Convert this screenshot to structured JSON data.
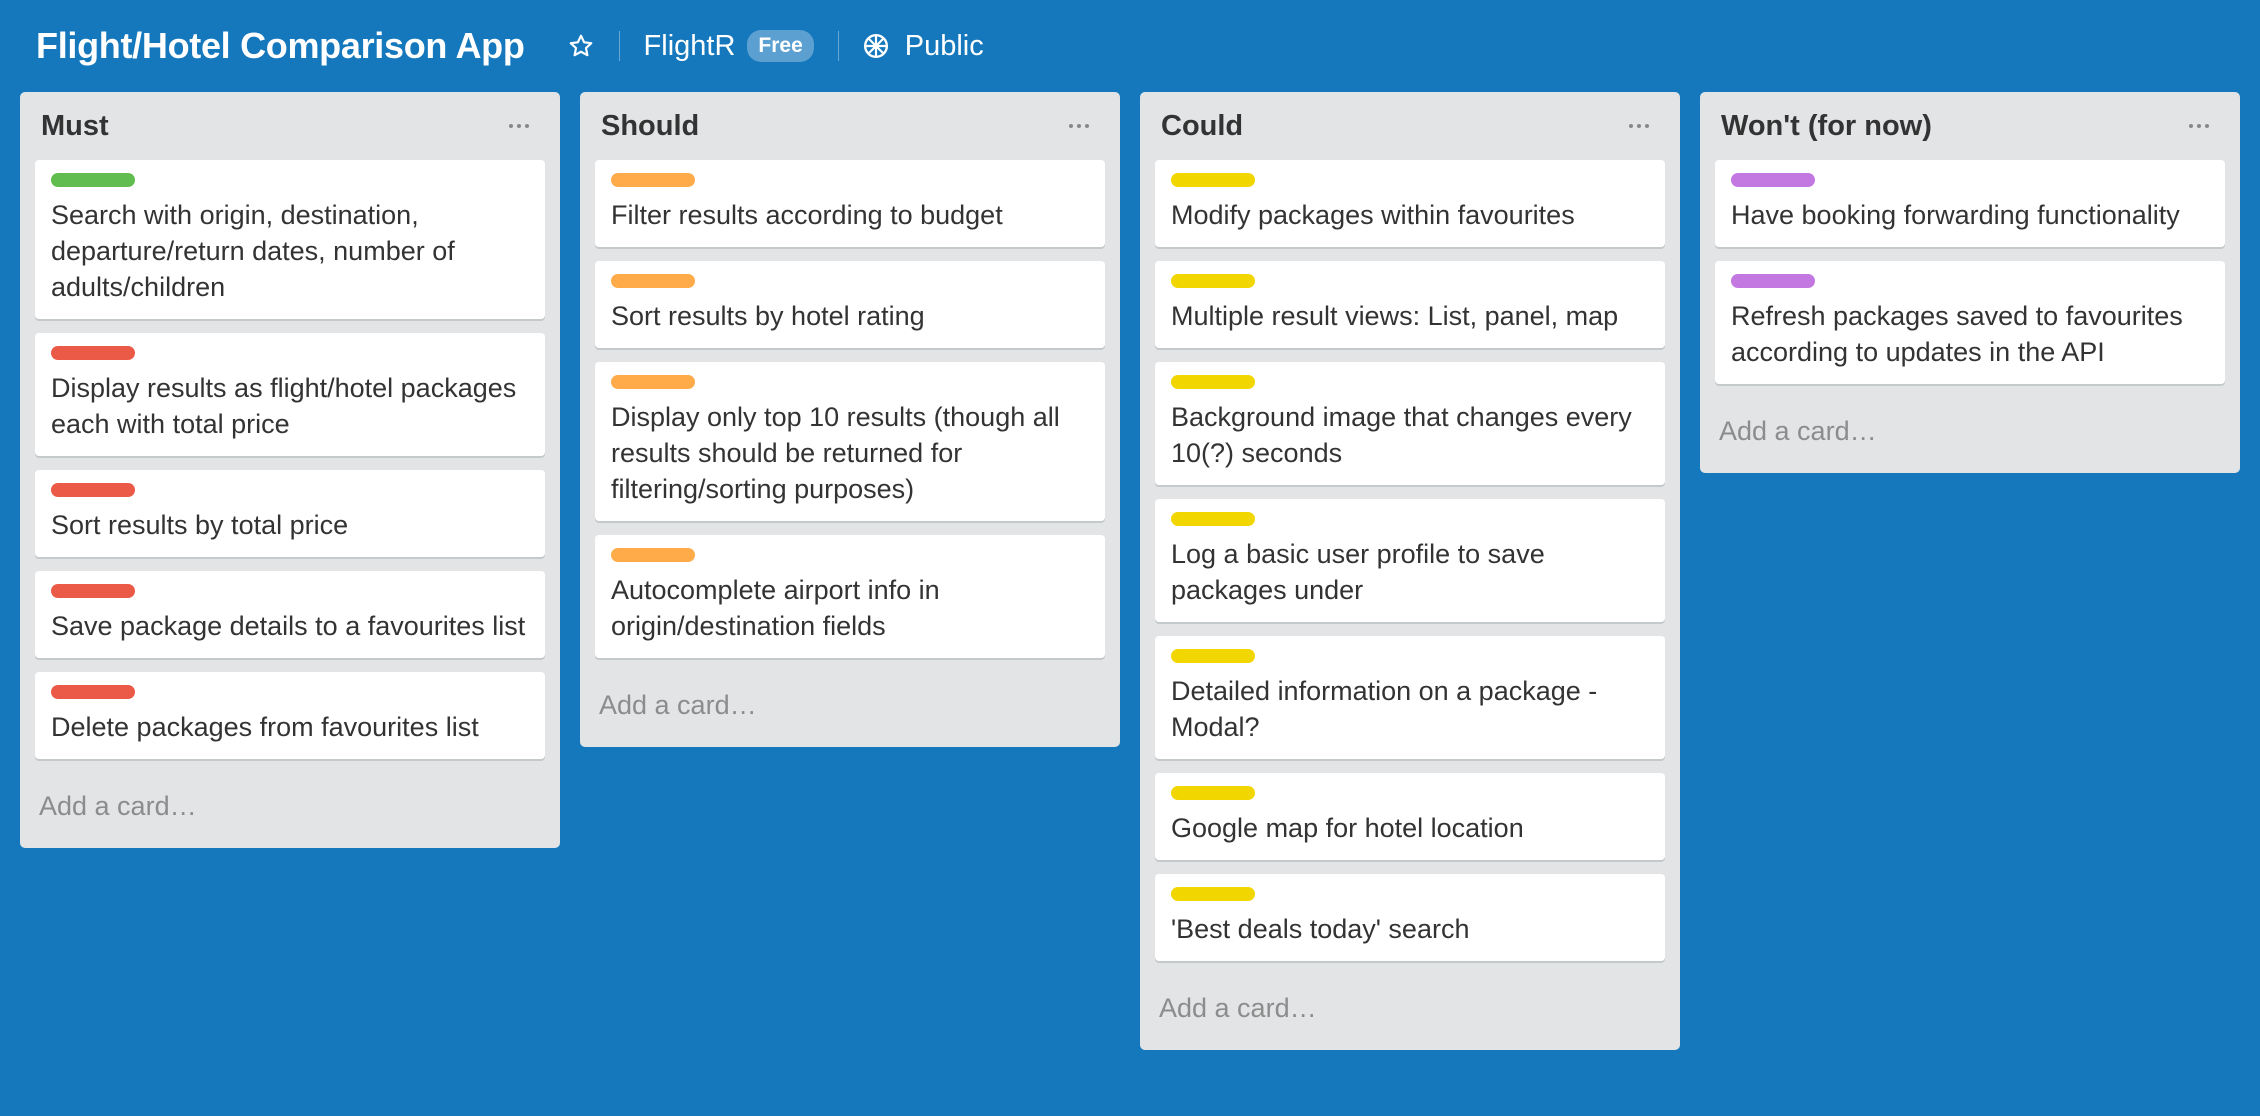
{
  "board": {
    "title": "Flight/Hotel Comparison App",
    "team": "FlightR",
    "plan_badge": "Free",
    "visibility": "Public",
    "icons": {
      "star": "star-icon",
      "visibility": "globe-icon"
    }
  },
  "colors": {
    "background": "#1578bd",
    "green": "#61bd4f",
    "red": "#eb5a46",
    "orange": "#ffab4a",
    "yellow": "#f2d600",
    "purple": "#c377e0"
  },
  "lists": [
    {
      "title": "Must",
      "add_card": "Add a card…",
      "cards": [
        {
          "label_color": "#61bd4f",
          "text": "Search with origin, destination, departure/return dates, number of adults/children"
        },
        {
          "label_color": "#eb5a46",
          "text": "Display results as flight/hotel packages each with total price"
        },
        {
          "label_color": "#eb5a46",
          "text": "Sort results by total price"
        },
        {
          "label_color": "#eb5a46",
          "text": "Save package details to a favourites list"
        },
        {
          "label_color": "#eb5a46",
          "text": "Delete packages from favourites list"
        }
      ]
    },
    {
      "title": "Should",
      "add_card": "Add a card…",
      "cards": [
        {
          "label_color": "#ffab4a",
          "text": "Filter results according to budget"
        },
        {
          "label_color": "#ffab4a",
          "text": "Sort results by hotel rating"
        },
        {
          "label_color": "#ffab4a",
          "text": "Display only top 10 results (though all results should be returned for filtering/sorting purposes)"
        },
        {
          "label_color": "#ffab4a",
          "text": "Autocomplete airport info in origin/destination fields"
        }
      ]
    },
    {
      "title": "Could",
      "add_card": "Add a card…",
      "cards": [
        {
          "label_color": "#f2d600",
          "text": "Modify packages within favourites"
        },
        {
          "label_color": "#f2d600",
          "text": "Multiple result views: List, panel, map"
        },
        {
          "label_color": "#f2d600",
          "text": "Background image that changes every 10(?) seconds"
        },
        {
          "label_color": "#f2d600",
          "text": "Log a basic user profile to save packages under"
        },
        {
          "label_color": "#f2d600",
          "text": "Detailed information on a package - Modal?"
        },
        {
          "label_color": "#f2d600",
          "text": "Google map for hotel location"
        },
        {
          "label_color": "#f2d600",
          "text": "'Best deals today' search"
        }
      ]
    },
    {
      "title": "Won't (for now)",
      "add_card": "Add a card…",
      "cards": [
        {
          "label_color": "#c377e0",
          "text": "Have booking forwarding functionality"
        },
        {
          "label_color": "#c377e0",
          "text": "Refresh packages saved to favourites according to updates in the API"
        }
      ]
    }
  ]
}
